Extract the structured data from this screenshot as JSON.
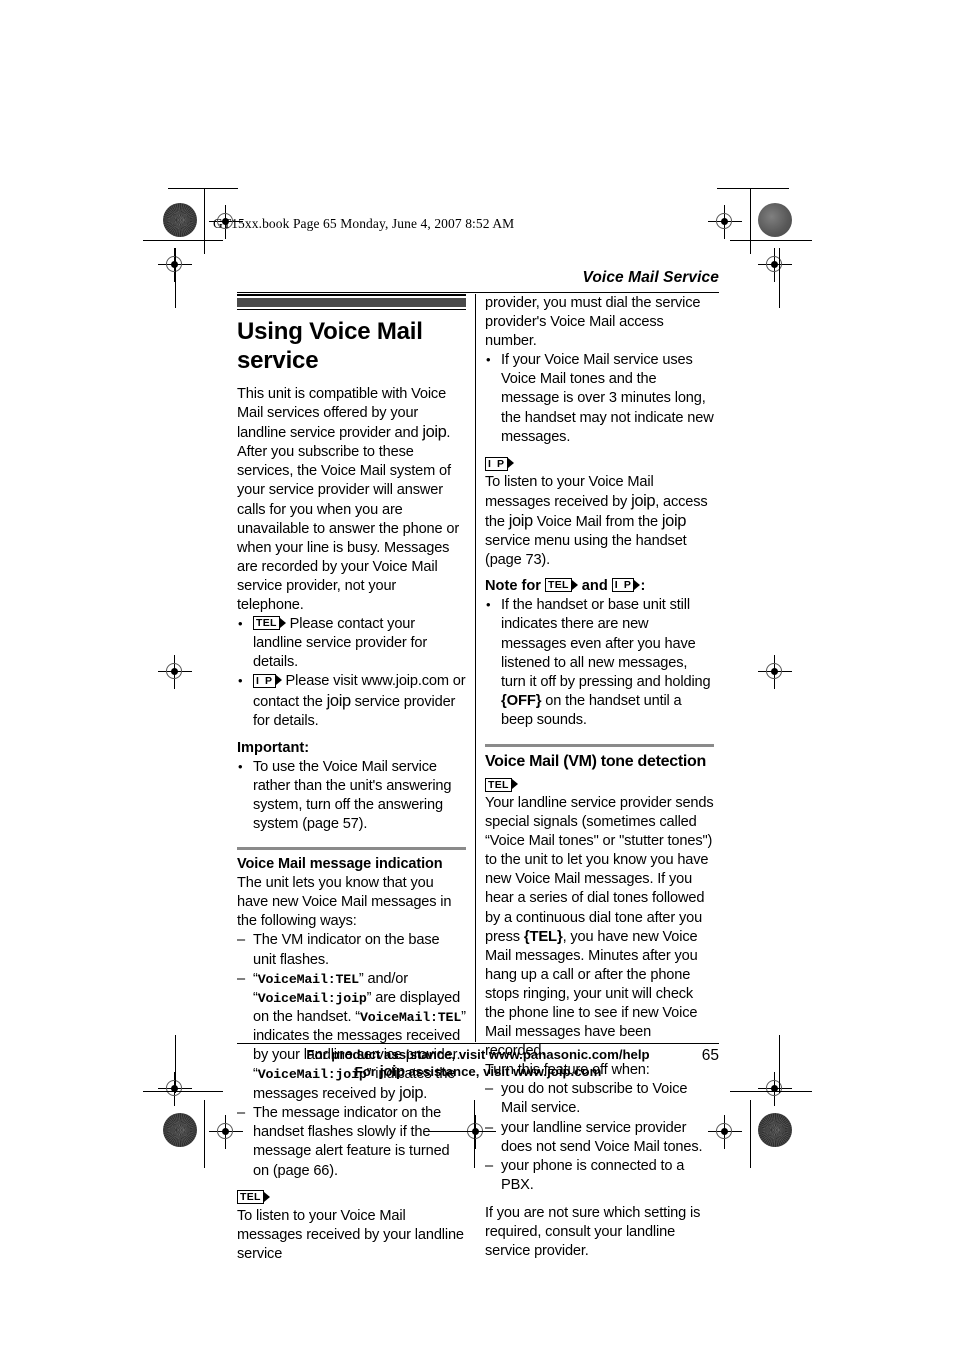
{
  "file_banner": "GT15xx.book  Page 65  Monday, June 4, 2007  8:52 AM",
  "running_head": "Voice Mail Service",
  "page_number": "65",
  "badges": {
    "tel": "TEL",
    "ip": "I P"
  },
  "footer": {
    "line1": "For product assistance, visit www.panasonic.com/help",
    "line2_pre": "For ",
    "line2_brand": "joip",
    "line2_post": " assistance, visit www.joip.com"
  },
  "left_column": {
    "chapter_title": "Using Voice Mail service",
    "intro_1": "This unit is compatible with Voice Mail services offered by your landline service provider and ",
    "intro_brand": "joip",
    "intro_2": ". After you subscribe to these services, the Voice Mail system of your service provider will answer calls for you when you are unavailable to answer the phone or when your line is busy. Messages are recorded by your Voice Mail service provider, not your telephone.",
    "bullet_tel": "Please contact your landline service provider for details.",
    "bullet_ip_1": "Please visit www.joip.com or contact the ",
    "bullet_ip_brand": "joip",
    "bullet_ip_2": " service provider for details.",
    "important_label": "Important:",
    "important_bullet": "To use the Voice Mail service rather than the unit's answering system, turn off the answering system (page 57).",
    "section_title": "Voice Mail message indication",
    "section_intro": "The unit lets you know that you have new Voice Mail messages in the following ways:",
    "dash_1": "The VM indicator on the base unit flashes.",
    "dash_2_a": "“",
    "dash_2_mono1": "VoiceMail:TEL",
    "dash_2_b": "” and/or “",
    "dash_2_mono2": "VoiceMail:joip",
    "dash_2_c": "” are displayed on the handset. “",
    "dash_2_mono3": "VoiceMail:TEL",
    "dash_2_d": "” indicates the messages received by your landline service provider. “",
    "dash_2_mono4": "VoiceMail:joip",
    "dash_2_e": "” indicates the messages received by ",
    "dash_2_brand": "joip",
    "dash_2_f": ".",
    "dash_3": "The message indicator on the handset flashes slowly if the message alert feature is turned on (page 66).",
    "tail_para": "To listen to your Voice Mail messages received by your landline service"
  },
  "right_column": {
    "cont_para": "provider, you must dial the service provider's Voice Mail access number.",
    "bullet_1": "If your Voice Mail service uses Voice Mail tones and the message is over 3 minutes long, the handset may not indicate new messages.",
    "ip_para_1": "To listen to your Voice Mail messages received by ",
    "ip_para_brand1": "joip",
    "ip_para_2": ", access the ",
    "ip_para_brand2": "joip",
    "ip_para_3": " Voice Mail from the ",
    "ip_para_brand3": "joip",
    "ip_para_4": " service menu using the handset (page 73).",
    "note_for_pre": "Note for ",
    "note_for_mid": " and ",
    "note_for_post": ":",
    "note_bullet_1": "If the handset or base unit still indicates there are new messages even after you have listened to all new messages, turn it off by pressing and holding ",
    "note_bullet_key": "{OFF}",
    "note_bullet_2": " on the handset until a beep sounds.",
    "section_title": "Voice Mail (VM) tone detection",
    "vm_para_1": "Your landline service provider sends special signals (sometimes called “Voice Mail tones\" or \"stutter tones\") to the unit to let you know you have new Voice Mail messages. If you hear a series of dial tones followed by a continuous dial tone after you press ",
    "vm_para_key": "{TEL}",
    "vm_para_2": ", you have new Voice Mail messages. Minutes after you hang up a call or after the phone stops ringing, your unit will check the phone line to see if new Voice Mail messages have been recorded.",
    "turn_off_intro": "Turn this feature off when:",
    "turn_off_1": "you do not subscribe to Voice Mail service.",
    "turn_off_2": "your landline service provider does not send Voice Mail tones.",
    "turn_off_3": "your phone is connected to a PBX.",
    "closing_para": "If you are not sure which setting is required, consult your landline service provider."
  }
}
